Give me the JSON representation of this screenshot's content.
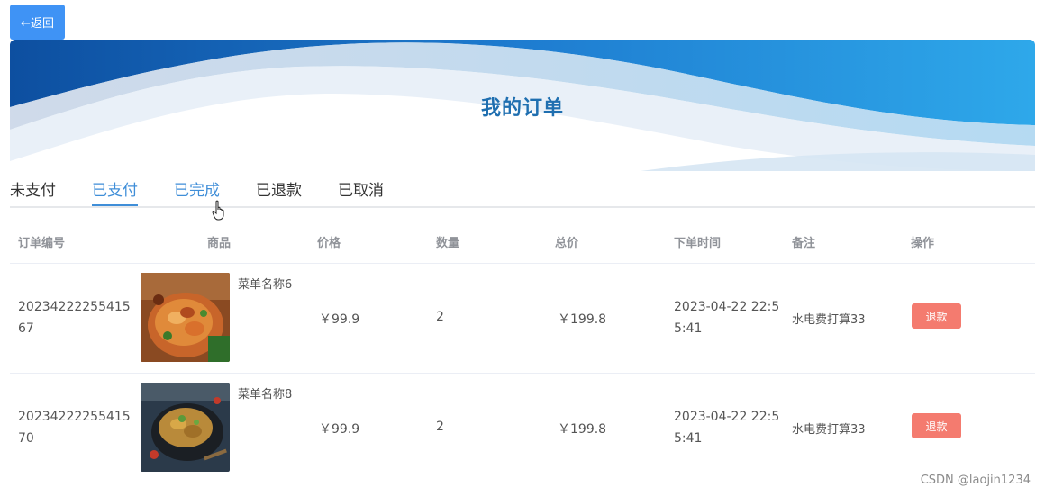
{
  "back_button": {
    "label": "←返回"
  },
  "banner": {
    "title": "我的订单"
  },
  "tabs": [
    {
      "label": "未支付",
      "state": "normal"
    },
    {
      "label": "已支付",
      "state": "active"
    },
    {
      "label": "已完成",
      "state": "hover"
    },
    {
      "label": "已退款",
      "state": "normal"
    },
    {
      "label": "已取消",
      "state": "normal"
    }
  ],
  "table": {
    "headers": [
      "订单编号",
      "商品",
      "价格",
      "数量",
      "总价",
      "下单时间",
      "备注",
      "操作"
    ],
    "rows": [
      {
        "order_no": "2023422225541567",
        "dish_name": "菜单名称6",
        "price": "￥99.9",
        "qty": "2",
        "total": "￥199.8",
        "time": "2023-04-22 22:55:41",
        "remark": "水电费打算33",
        "action": "退款"
      },
      {
        "order_no": "2023422225541570",
        "dish_name": "菜单名称8",
        "price": "￥99.9",
        "qty": "2",
        "total": "￥199.8",
        "time": "2023-04-22 22:55:41",
        "remark": "水电费打算33",
        "action": "退款"
      }
    ]
  },
  "watermark": "CSDN @laojin1234",
  "colors": {
    "primary": "#3f93f5",
    "danger": "#f47b6f",
    "tab_active": "#3f8ed8"
  }
}
